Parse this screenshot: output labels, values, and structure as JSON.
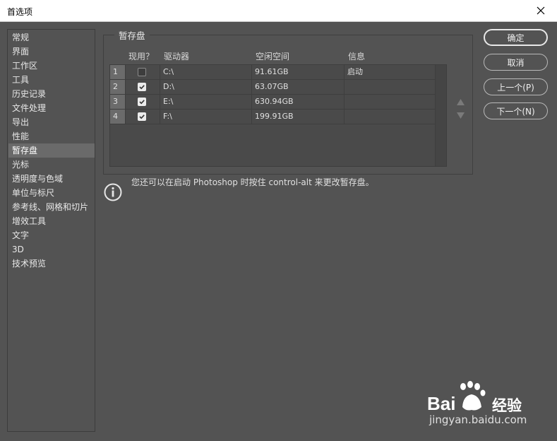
{
  "window": {
    "title": "首选项"
  },
  "sidebar": {
    "items": [
      {
        "label": "常规"
      },
      {
        "label": "界面"
      },
      {
        "label": "工作区"
      },
      {
        "label": "工具"
      },
      {
        "label": "历史记录"
      },
      {
        "label": "文件处理"
      },
      {
        "label": "导出"
      },
      {
        "label": "性能"
      },
      {
        "label": "暂存盘",
        "active": true
      },
      {
        "label": "光标"
      },
      {
        "label": "透明度与色域"
      },
      {
        "label": "单位与标尺"
      },
      {
        "label": "参考线、网格和切片"
      },
      {
        "label": "增效工具"
      },
      {
        "label": "文字"
      },
      {
        "label": "3D"
      },
      {
        "label": "技术预览"
      }
    ]
  },
  "scratch": {
    "group_title": "暂存盘",
    "columns": {
      "active": "现用？",
      "drive": "驱动器",
      "free": "空闲空间",
      "info": "信息"
    },
    "rows": [
      {
        "index": "1",
        "checked": false,
        "drive": "C:\\",
        "free": "91.61GB",
        "info": "启动"
      },
      {
        "index": "2",
        "checked": true,
        "drive": "D:\\",
        "free": "63.07GB",
        "info": ""
      },
      {
        "index": "3",
        "checked": true,
        "drive": "E:\\",
        "free": "630.94GB",
        "info": ""
      },
      {
        "index": "4",
        "checked": true,
        "drive": "F:\\",
        "free": "199.91GB",
        "info": ""
      }
    ]
  },
  "note": {
    "text": "您还可以在启动 Photoshop 时按住 control-alt 来更改暂存盘。"
  },
  "buttons": {
    "ok": "确定",
    "cancel": "取消",
    "prev": "上一个(P)",
    "next": "下一个(N)"
  },
  "watermark": {
    "brand": "Bai",
    "brand2": "经验",
    "url": "jingyan.baidu.com"
  },
  "colors": {
    "background": "#535353",
    "active_item": "#6a6a6a",
    "titlebar": "#ffffff"
  }
}
